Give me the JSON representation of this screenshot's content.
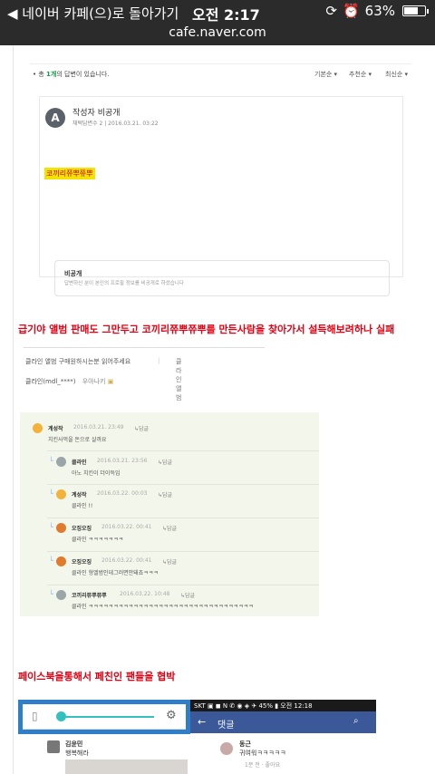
{
  "status": {
    "back_text": "◀ 네이버 카페(으)로 돌아가기",
    "time": "오전 2:17",
    "battery": "63%",
    "battery_level": 0.63,
    "url": "cafe.naver.com"
  },
  "answer_card": {
    "count_text_pre": "• 총",
    "count_value": "1개",
    "count_text_post": "의 답변이 있습니다.",
    "sort_options": [
      "기본순 ▾",
      "추천순 ▾",
      "최신순 ▾"
    ],
    "avatar_letter": "A",
    "title": "작성자 비공개",
    "meta": "채택답변수 2  |  2016.03.21. 03:22",
    "highlight_text": "코끼리쮸뿌쮸뿌",
    "private_title": "비공개",
    "private_desc": "답변하신 분이 본인의 프로필 정보를 비공개로 하셨습니다"
  },
  "headline1": "급기야 앨범 판매도 그만두고 코끼리쮸뿌쮸뿌를 만든사람을 찾아가서 설득해보려하나 실패",
  "post_meta": {
    "title": "클라인 앨범 구매원하시는분 읽어주세요",
    "category": "클라인앨범",
    "author": "클라인(mdl_****)",
    "author_extra": "우아나키"
  },
  "comments": [
    {
      "name": "계성작",
      "date": "2016.03.21. 23:49",
      "reply": "↳답글",
      "body": "치킨사먹을 돈으로 살까요"
    },
    {
      "name": "클라인",
      "date": "2016.03.21. 23:56",
      "reply": "↳답글",
      "body": "아노 치킨이 더이득임"
    },
    {
      "name": "계성작",
      "date": "2016.03.22. 00:03",
      "reply": "↳답글",
      "body": "클라인 !!"
    },
    {
      "name": "오징오징",
      "date": "2016.03.22. 00:41",
      "reply": "↳답글",
      "body": "클라인 ㅋㅋㅋㅋㅋㅋㅋ"
    },
    {
      "name": "오징오징",
      "date": "2016.03.22. 00:41",
      "reply": "↳답글",
      "body": "클라인 형앨범인데그러면안돼죠ㅋㅋㅋ"
    },
    {
      "name": "코끼리쮸뿌쮸뿌",
      "date": "2016.03.22. 10:48",
      "reply": "↳답글",
      "body": "클라인 ㅋㅋㅋㅋㅋㅋㅋㅋㅋㅋㅋㅋㅋㅋㅋㅋㅋㅋㅋㅋㅋㅋㅋㅋㅋㅋㅋㅋㅋㅋㅋㅋㅋ"
    }
  ],
  "headline2": "페이스북을통해서 페친인 팬들을 협박",
  "embedded": {
    "android_status": "SKT ▣ ◼     N ✆ ◉ ◈ ✈ 45% ▮ 오전 12:18",
    "fb_title": "댓글",
    "left_person_name": "김윤민",
    "left_person_text": "행복해라",
    "right_person_name": "동근",
    "right_person_text": "귀여워ㅋㅋㅋㅋㅋ",
    "right_meta": "1분 전 · 좋아요"
  }
}
